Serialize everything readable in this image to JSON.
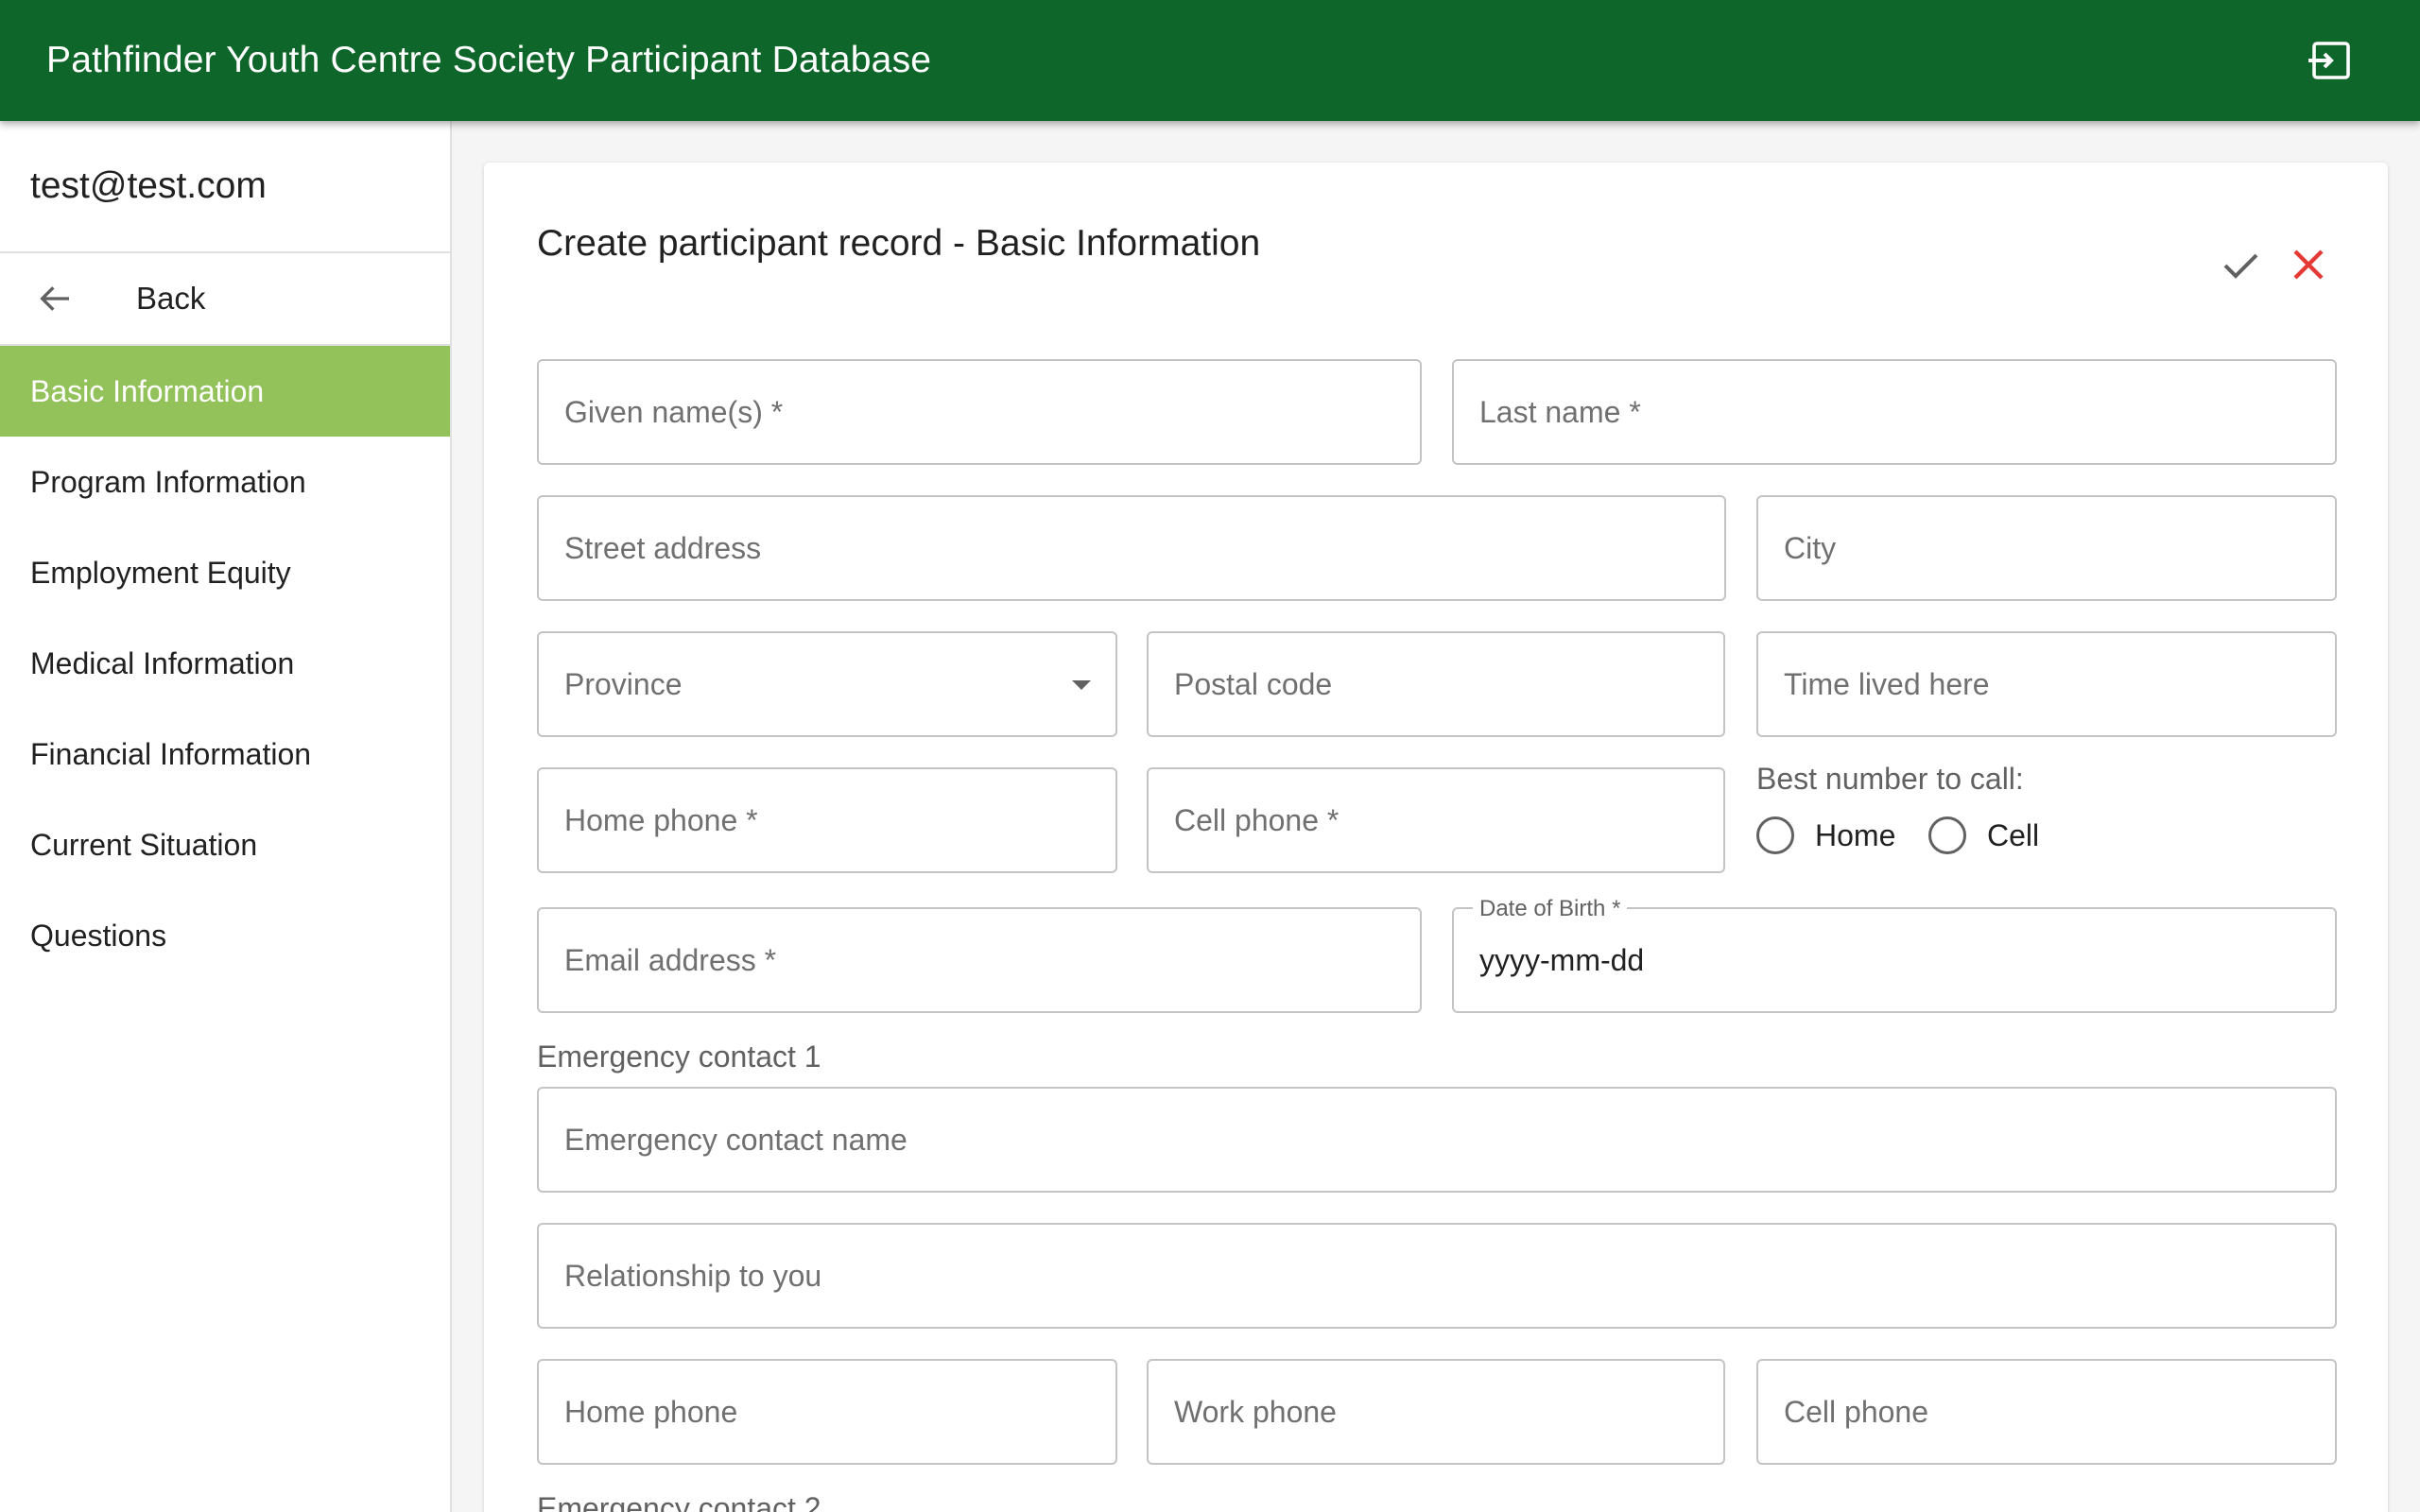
{
  "app": {
    "title": "Pathfinder Youth Centre Society Participant Database",
    "icons": {
      "logout": "logout-icon"
    }
  },
  "sidebar": {
    "user_email": "test@test.com",
    "back_label": "Back",
    "items": [
      {
        "label": "Basic Information",
        "active": true
      },
      {
        "label": "Program Information",
        "active": false
      },
      {
        "label": "Employment Equity",
        "active": false
      },
      {
        "label": "Medical Information",
        "active": false
      },
      {
        "label": "Financial Information",
        "active": false
      },
      {
        "label": "Current Situation",
        "active": false
      },
      {
        "label": "Questions",
        "active": false
      }
    ]
  },
  "form": {
    "title": "Create participant record - Basic Information",
    "given_name": "Given name(s) *",
    "last_name": "Last name *",
    "street_address": "Street address",
    "city": "City",
    "province": "Province",
    "postal_code": "Postal code",
    "time_lived_here": "Time lived here",
    "home_phone": "Home phone *",
    "cell_phone": "Cell phone *",
    "best_number_label": "Best number to call:",
    "best_number_options": [
      "Home",
      "Cell"
    ],
    "email": "Email address *",
    "dob_label": "Date of Birth *",
    "dob_value": "yyyy-mm-dd",
    "emergency1_label": "Emergency contact 1",
    "emergency_name": "Emergency contact name",
    "relationship": "Relationship to you",
    "em_home_phone": "Home phone",
    "em_work_phone": "Work phone",
    "em_cell_phone": "Cell phone",
    "emergency2_label": "Emergency contact 2"
  },
  "colors": {
    "appbar": "#0f662b",
    "active_nav": "#93c25b",
    "cancel": "#e53935"
  }
}
